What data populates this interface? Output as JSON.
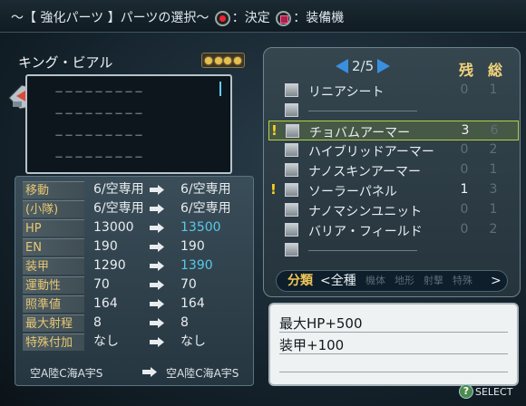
{
  "header": {
    "title": "～【 強化パーツ 】パーツの選択～",
    "confirm_label": "：決定",
    "equipped_label": "：装備機"
  },
  "unit": {
    "name": "キング・ビアル",
    "rank_stars": 4,
    "part_slots": [
      "－－－－－－－－－",
      "－－－－－－－－－",
      "－－－－－－－－－",
      "－－－－－－－－－"
    ]
  },
  "stats": [
    {
      "label": "移動",
      "before": "6/空専用",
      "after": "6/空専用",
      "changed": false
    },
    {
      "label": "(小隊)",
      "before": "6/空専用",
      "after": "6/空専用",
      "changed": false
    },
    {
      "label": "HP",
      "before": "13000",
      "after": "13500",
      "changed": true
    },
    {
      "label": "EN",
      "before": "190",
      "after": "190",
      "changed": false
    },
    {
      "label": "装甲",
      "before": "1290",
      "after": "1390",
      "changed": true
    },
    {
      "label": "運動性",
      "before": "70",
      "after": "70",
      "changed": false
    },
    {
      "label": "照準値",
      "before": "164",
      "after": "164",
      "changed": false
    },
    {
      "label": "最大射程",
      "before": "8",
      "after": "8",
      "changed": false
    },
    {
      "label": "特殊付加",
      "before": "なし",
      "after": "なし",
      "changed": false
    }
  ],
  "terrain": {
    "before": "空A陸C海A宇S",
    "after": "空A陸C海A宇S"
  },
  "list": {
    "page_current": "2",
    "page_total": "5",
    "col_remaining": "残",
    "col_total": "総",
    "items": [
      {
        "name": "リニアシート",
        "remaining": "0",
        "total": "1",
        "alert": false,
        "selected": false
      },
      {
        "name": "",
        "remaining": "",
        "total": "",
        "alert": false,
        "selected": false
      },
      {
        "name": "チョバムアーマー",
        "remaining": "3",
        "total": "6",
        "alert": true,
        "selected": true
      },
      {
        "name": "ハイブリッドアーマー",
        "remaining": "0",
        "total": "2",
        "alert": false,
        "selected": false
      },
      {
        "name": "ナノスキンアーマー",
        "remaining": "0",
        "total": "1",
        "alert": false,
        "selected": false
      },
      {
        "name": "ソーラーパネル",
        "remaining": "1",
        "total": "3",
        "alert": true,
        "selected": false
      },
      {
        "name": "ナノマシンユニット",
        "remaining": "0",
        "total": "1",
        "alert": false,
        "selected": false
      },
      {
        "name": "バリア・フィールド",
        "remaining": "0",
        "total": "2",
        "alert": false,
        "selected": false
      },
      {
        "name": "",
        "remaining": "",
        "total": "",
        "alert": false,
        "selected": false
      }
    ]
  },
  "category": {
    "label": "分類",
    "current": "<全種",
    "options": [
      "機体",
      "地形",
      "射撃",
      "特殊"
    ],
    "next": ">"
  },
  "description": {
    "lines": [
      "最大HP+500",
      "装甲+100"
    ]
  },
  "footer": {
    "select_label": "SELECT"
  },
  "colors": {
    "accent_blue": "#58c9e8",
    "label_gold": "#e7c774",
    "select_green": "#b6d045"
  }
}
